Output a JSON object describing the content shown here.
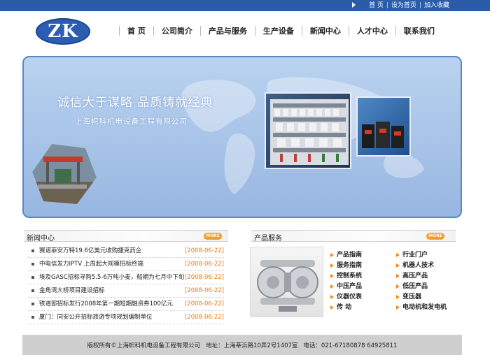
{
  "topbar": {
    "links": [
      "首 页",
      "设为首页",
      "加入收藏"
    ]
  },
  "logo": {
    "text": "ZK"
  },
  "nav": {
    "items": [
      "首 页",
      "公司简介",
      "产品与服务",
      "生产设备",
      "新闻中心",
      "人才中心",
      "联系我们"
    ]
  },
  "banner": {
    "slogan": "诚信大于谋略  品质铸就经典",
    "company": "上海帜科机电设备工程有限公司"
  },
  "news": {
    "title": "新闻中心",
    "more": "MORE",
    "items": [
      {
        "title": "赛诺菲安万特19.6亿美元收购捷克药企",
        "date": "[2008-06-22]"
      },
      {
        "title": "中电信发力IPTV 上周起大规模招标终端",
        "date": "[2008-06-22]"
      },
      {
        "title": "埃及GASC招标寻购5.5-6万吨小麦，船期为七月中下旬",
        "date": "[2008-06-22]"
      },
      {
        "title": "金角湾大桥项目建设招标",
        "date": "[2008-06-22]"
      },
      {
        "title": "铁道部招标发行2008年第一期短期融资券100亿元",
        "date": "[2008-06-22]"
      },
      {
        "title": "厦门：同安公开招标旅游专项规划编制单位",
        "date": "[2008-06-22]"
      }
    ]
  },
  "products": {
    "title": "产品服务",
    "more": "MORE",
    "left": [
      "产品指南",
      "服务指南",
      "控制系统",
      "中压产品",
      "仪器仪表",
      "传    动"
    ],
    "right": [
      "行业门户",
      "机器人技术",
      "高压产品",
      "低压产品",
      "变压器",
      "电动机和发电机"
    ]
  },
  "footer": {
    "copyright": "版权所有©上海帜科机电设备工程有限公司",
    "address": "地址：上海莘浜路10弄2号1407室",
    "phone": "电话：021-67180878 64925811"
  },
  "colors": {
    "topbar": "#2a5ca8",
    "logo": "#2b5db4",
    "date": "#e47a12",
    "more_button": "#f59a2b",
    "footer": "#cfcfcf"
  }
}
